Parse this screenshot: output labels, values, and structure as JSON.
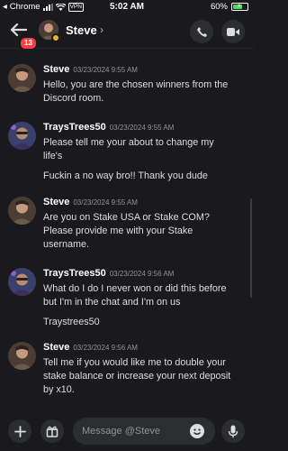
{
  "status_bar": {
    "back_app": "Chrome",
    "time": "5:02 AM",
    "vpn": "VPN",
    "battery": "60%"
  },
  "header": {
    "name": "Steve",
    "unread_badge": "13"
  },
  "messages": [
    {
      "author": "Steve",
      "timestamp": "03/23/2024 9:55 AM",
      "lines": [
        "Hello, you are the chosen winners from the",
        "Discord room."
      ]
    },
    {
      "author": "TraysTrees50",
      "timestamp": "03/23/2024 9:55 AM",
      "lines": [
        "Please tell me your about to change my",
        "life's",
        "Fuckin a no way bro!! Thank you dude"
      ]
    },
    {
      "author": "Steve",
      "timestamp": "03/23/2024 9:55 AM",
      "lines": [
        "Are you on Stake USA or Stake COM?",
        "Please provide me with your Stake",
        "username."
      ]
    },
    {
      "author": "TraysTrees50",
      "timestamp": "03/23/2024 9:56 AM",
      "lines": [
        "What do I do I never won or did this before",
        "but I'm in the chat and I'm on us",
        "Traystrees50"
      ]
    },
    {
      "author": "Steve",
      "timestamp": "03/23/2024 9:56 AM",
      "lines": [
        "Tell me if you would like me to double your",
        "stake balance or increase your next deposit",
        "by x10."
      ]
    }
  ],
  "input": {
    "placeholder": "Message @Steve"
  },
  "colors": {
    "background": "#1a1a1e",
    "badge_red": "#f23f43",
    "idle_yellow": "#f0b232"
  }
}
